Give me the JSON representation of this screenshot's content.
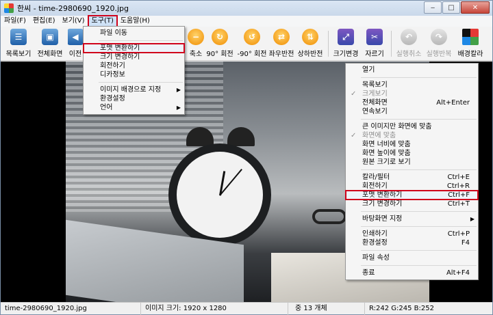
{
  "window": {
    "title": "한씨 - time-2980690_1920.jpg"
  },
  "menubar": {
    "items": [
      "파일(F)",
      "편집(E)",
      "보기(V)",
      "도구(T)",
      "도움말(H)"
    ],
    "active_index": 3
  },
  "toolbar": {
    "buttons": [
      {
        "label": "목록보기",
        "icon": "list-view-icon",
        "enabled": true
      },
      {
        "label": "전체화면",
        "icon": "fullscreen-icon",
        "enabled": true
      },
      {
        "label": "이전",
        "icon": "previous-icon",
        "enabled": true
      },
      {
        "label": "축소",
        "icon": "zoom-out-icon",
        "enabled": true
      },
      {
        "label": "90° 회전",
        "icon": "rotate-cw-icon",
        "enabled": true
      },
      {
        "label": "-90° 회전",
        "icon": "rotate-ccw-icon",
        "enabled": true
      },
      {
        "label": "좌우반전",
        "icon": "flip-horizontal-icon",
        "enabled": true
      },
      {
        "label": "상하반전",
        "icon": "flip-vertical-icon",
        "enabled": true
      },
      {
        "label": "크기변경",
        "icon": "resize-icon",
        "enabled": true
      },
      {
        "label": "자르기",
        "icon": "crop-icon",
        "enabled": true
      },
      {
        "label": "실행취소",
        "icon": "undo-icon",
        "enabled": false
      },
      {
        "label": "실행반복",
        "icon": "redo-icon",
        "enabled": false
      },
      {
        "label": "배경칼라",
        "icon": "background-color-icon",
        "enabled": true
      }
    ]
  },
  "tools_menu": {
    "items": [
      {
        "label": "파일 이동",
        "has_submenu": false
      },
      {
        "separator": true
      },
      {
        "label": "포맷 변환하기",
        "has_submenu": false,
        "highlighted": true
      },
      {
        "label": "크기 변경하기",
        "has_submenu": false
      },
      {
        "label": "회전하기",
        "has_submenu": false
      },
      {
        "label": "디카정보",
        "has_submenu": false
      },
      {
        "separator": true
      },
      {
        "label": "이미지 배경으로 지정",
        "has_submenu": true
      },
      {
        "label": "환경설정",
        "has_submenu": false
      },
      {
        "label": "언어",
        "has_submenu": true
      }
    ]
  },
  "context_menu": {
    "items": [
      {
        "label": "열기"
      },
      {
        "separator": true
      },
      {
        "label": "목록보기"
      },
      {
        "label": "크게보기",
        "checked": true,
        "disabled": true
      },
      {
        "label": "전체화면",
        "shortcut": "Alt+Enter"
      },
      {
        "label": "연속보기"
      },
      {
        "separator": true
      },
      {
        "label": "큰 이미지만 화면에 맞춤"
      },
      {
        "label": "화면에 맞춤",
        "checked": true,
        "disabled": true
      },
      {
        "label": "화면 너비에 맞춤"
      },
      {
        "label": "화면 높이에 맞춤"
      },
      {
        "label": "원본 크기로 보기"
      },
      {
        "separator": true
      },
      {
        "label": "칼라/필터",
        "shortcut": "Ctrl+E"
      },
      {
        "label": "회전하기",
        "shortcut": "Ctrl+R"
      },
      {
        "label": "포맷 변환하기",
        "shortcut": "Ctrl+F",
        "highlighted": true
      },
      {
        "label": "크기 변경하기",
        "shortcut": "Ctrl+T"
      },
      {
        "separator": true
      },
      {
        "label": "바탕화면 지정",
        "has_submenu": true
      },
      {
        "separator": true
      },
      {
        "label": "인쇄하기",
        "shortcut": "Ctrl+P"
      },
      {
        "label": "환경설정",
        "shortcut": "F4"
      },
      {
        "separator": true
      },
      {
        "label": "파일 속성"
      },
      {
        "separator": true
      },
      {
        "label": "종료",
        "shortcut": "Alt+F4"
      }
    ]
  },
  "statusbar": {
    "filename": "time-2980690_1920.jpg",
    "image_size": "이미지 크기: 1920 x 1280",
    "count": "중 13 개체",
    "color_info": "R:242 G:245 B:252"
  },
  "colors": {
    "highlight_border": "#d0021b",
    "menu_bg": "#f5f5f5"
  }
}
